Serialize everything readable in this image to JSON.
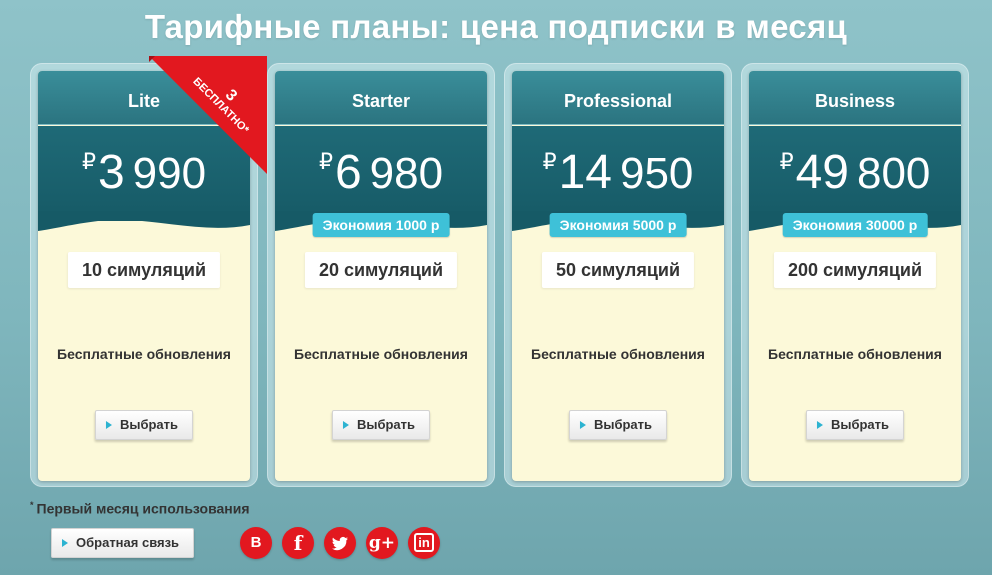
{
  "page": {
    "title": "Тарифные планы: цена подписки в месяц",
    "footnote_mark": "*",
    "footnote": "Первый месяц использования",
    "feedback_label": "Обратная связь"
  },
  "ribbon": {
    "number": "3",
    "label": "БЕСПЛАТНО*",
    "color": "#e2181f"
  },
  "colors": {
    "header": "#2b7480",
    "price_bg": "#1a606c",
    "savings_badge": "#3ec1d8",
    "card_bg": "#fcf9d9",
    "social": "#e2181f"
  },
  "currency_symbol": "₽",
  "plans": [
    {
      "name": "Lite",
      "price_big": "3",
      "price_rest": "990",
      "savings": "",
      "simulations": "10 симуляций",
      "updates": "Бесплатные обновления",
      "button": "Выбрать"
    },
    {
      "name": "Starter",
      "price_big": "6",
      "price_rest": "980",
      "savings": "Экономия 1000 р",
      "simulations": "20 симуляций",
      "updates": "Бесплатные обновления",
      "button": "Выбрать"
    },
    {
      "name": "Professional",
      "price_big": "14",
      "price_rest": "950",
      "savings": "Экономия 5000 р",
      "simulations": "50 симуляций",
      "updates": "Бесплатные обновления",
      "button": "Выбрать"
    },
    {
      "name": "Business",
      "price_big": "49",
      "price_rest": "800",
      "savings": "Экономия 30000 р",
      "simulations": "200 симуляций",
      "updates": "Бесплатные обновления",
      "button": "Выбрать"
    }
  ],
  "social": [
    {
      "name": "vk-icon",
      "glyph": "B"
    },
    {
      "name": "facebook-icon",
      "glyph": "f"
    },
    {
      "name": "twitter-icon",
      "glyph": ""
    },
    {
      "name": "google-plus-icon",
      "glyph": "g+"
    },
    {
      "name": "linkedin-icon",
      "glyph": "in"
    }
  ]
}
